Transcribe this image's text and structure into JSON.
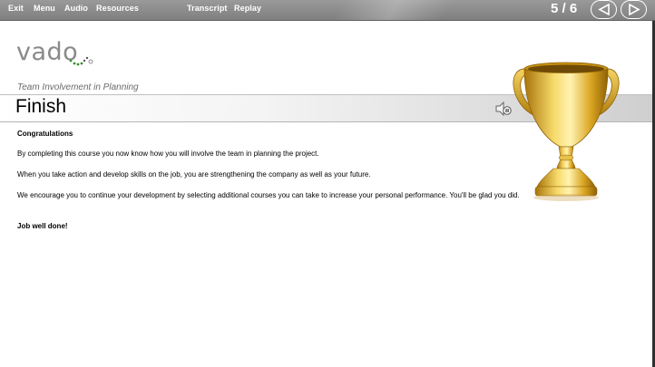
{
  "nav": {
    "exit": "Exit",
    "menu": "Menu",
    "audio": "Audio",
    "resources": "Resources",
    "transcript": "Transcript",
    "replay": "Replay",
    "page_counter": "5 / 6"
  },
  "header": {
    "logo_text": "vado",
    "subtitle": "Team Involvement in Planning",
    "title": "Finish"
  },
  "content": {
    "heading": "Congratulations",
    "p1": "By completing this course you now know how you will involve the team in planning the project.",
    "p2": "When you take action and develop skills on the job, you are strengthening the company as well as your future.",
    "p3": "We encourage you to continue your development by selecting additional courses you can take to increase your personal performance. You'll be glad you did.",
    "closing": "Job well done!"
  },
  "icons": {
    "prev": "back-arrow-icon",
    "next": "forward-arrow-icon",
    "audio": "speaker-pause-icon",
    "trophy": "trophy-image"
  },
  "colors": {
    "topbar": "#8c8c8c",
    "accent_green": "#3a8f2e",
    "trophy_gold": "#d4a017"
  }
}
